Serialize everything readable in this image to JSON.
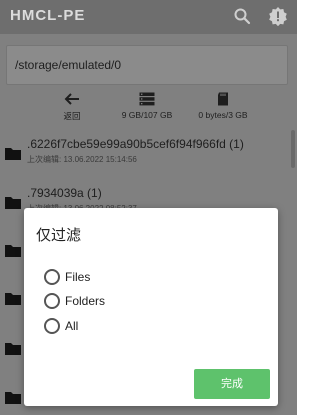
{
  "appbar": {
    "title": "HMCL-PE",
    "search_icon": "search-icon",
    "alert_icon": "alert-icon"
  },
  "path": {
    "value": "/storage/emulated/0"
  },
  "toolbar": {
    "back_label": "返回",
    "ram_label": "9 GB/107 GB",
    "sd_label": "0 bytes/3 GB"
  },
  "files": [
    {
      "name": ".6226f7cbe59e99a90b5cef6f94f966fd (1)",
      "modified": "上次编辑: 13.06.2022 15:14:56"
    },
    {
      "name": ".7934039a (1)",
      "modified": "上次编辑: 13.06.2022 08:52:37"
    }
  ],
  "dialog": {
    "title": "仅过滤",
    "options": [
      "Files",
      "Folders",
      "All"
    ],
    "done_label": "完成"
  },
  "colors": {
    "overlay_gray": "#808080",
    "appbar": "#6e6e6e",
    "done_button": "#5ec26c"
  }
}
